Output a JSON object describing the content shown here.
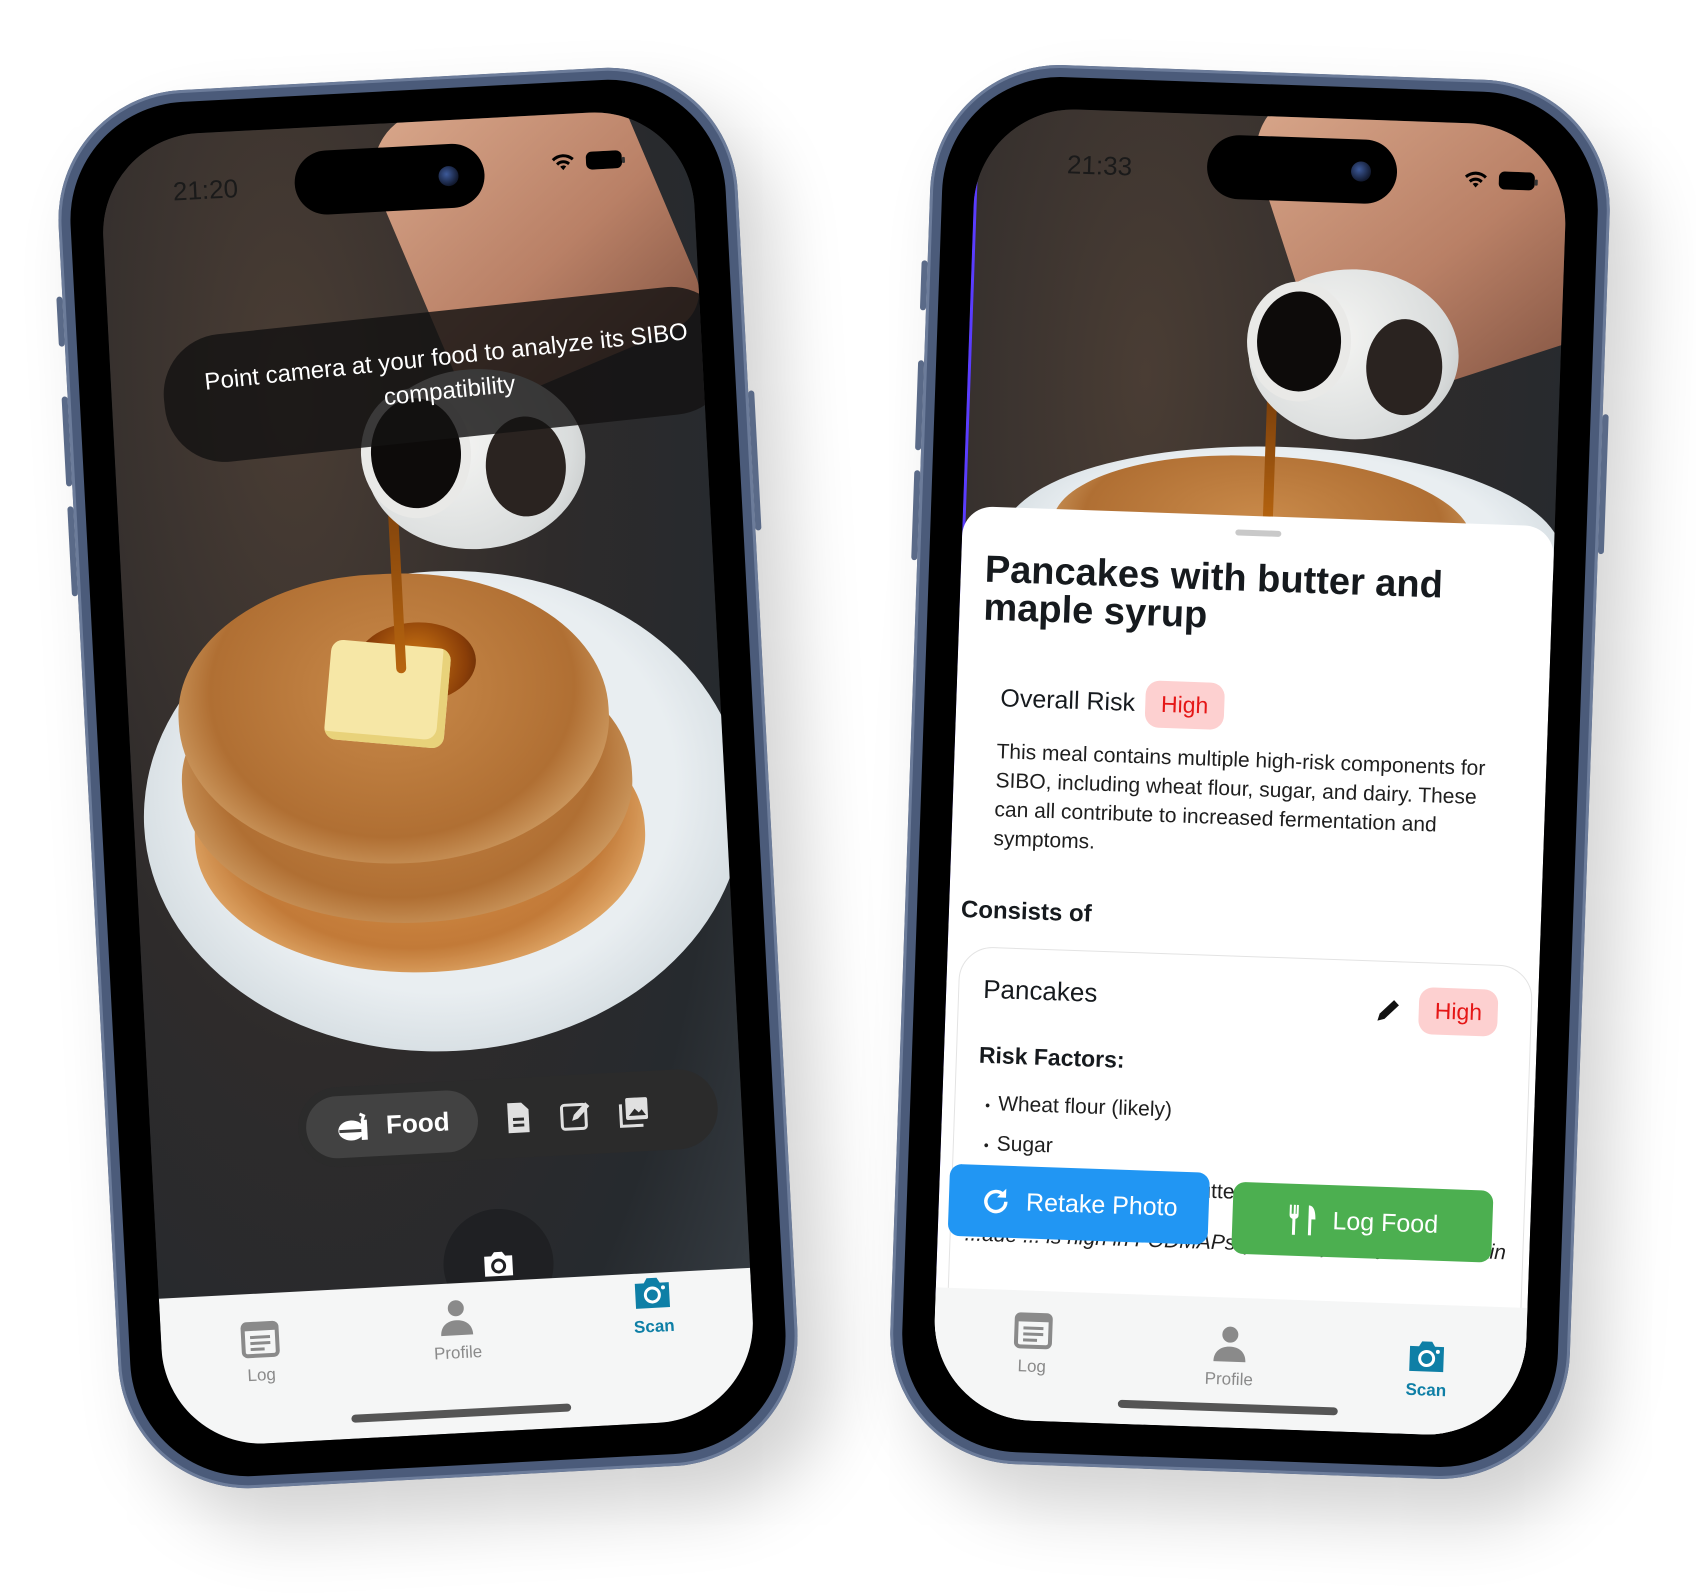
{
  "left_phone": {
    "status": {
      "time": "21:20",
      "wifi_icon": "wifi-icon",
      "battery_icon": "battery-icon"
    },
    "hint": "Point camera at your food to analyze its SIBO compatibility",
    "mode_bar": {
      "active": {
        "label": "Food",
        "icon": "food-icon"
      },
      "others": [
        {
          "name": "document-icon"
        },
        {
          "name": "edit-icon"
        },
        {
          "name": "gallery-icon"
        }
      ]
    },
    "shutter_icon": "camera-icon",
    "tabs": [
      {
        "label": "Log",
        "icon": "log-icon",
        "active": false
      },
      {
        "label": "Profile",
        "icon": "profile-icon",
        "active": false
      },
      {
        "label": "Scan",
        "icon": "camera-icon",
        "active": true
      }
    ]
  },
  "right_phone": {
    "status": {
      "time": "21:33"
    },
    "result": {
      "title": "Pancakes with butter and maple syrup",
      "overall_risk_label": "Overall Risk",
      "overall_risk": "High",
      "summary": "This meal contains multiple high-risk components for SIBO, including wheat flour, sugar, and dairy. These can all contribute to increased fermentation and symptoms.",
      "consists_of_label": "Consists of",
      "items": [
        {
          "name": "Pancakes",
          "risk": "High",
          "risk_factors_label": "Risk Factors:",
          "risk_factors": [
            "Wheat flour (likely)",
            "Sugar",
            "Possible dairy (milk, butter)"
          ],
          "note_partial": "...ade ... is high in FODMAPs (fructans). They also contain"
        }
      ]
    },
    "actions": {
      "retake": "Retake Photo",
      "log": "Log Food"
    },
    "tabs": [
      {
        "label": "Log",
        "active": false
      },
      {
        "label": "Profile",
        "active": false
      },
      {
        "label": "Scan",
        "active": true
      }
    ]
  },
  "colors": {
    "accent_scan": "#0e7fa6",
    "risk_high_text": "#e51616",
    "risk_high_bg": "#fdd0d0",
    "retake_button": "#2196f3",
    "log_button": "#4caf50",
    "phone_frame": "#4b5b7a"
  }
}
